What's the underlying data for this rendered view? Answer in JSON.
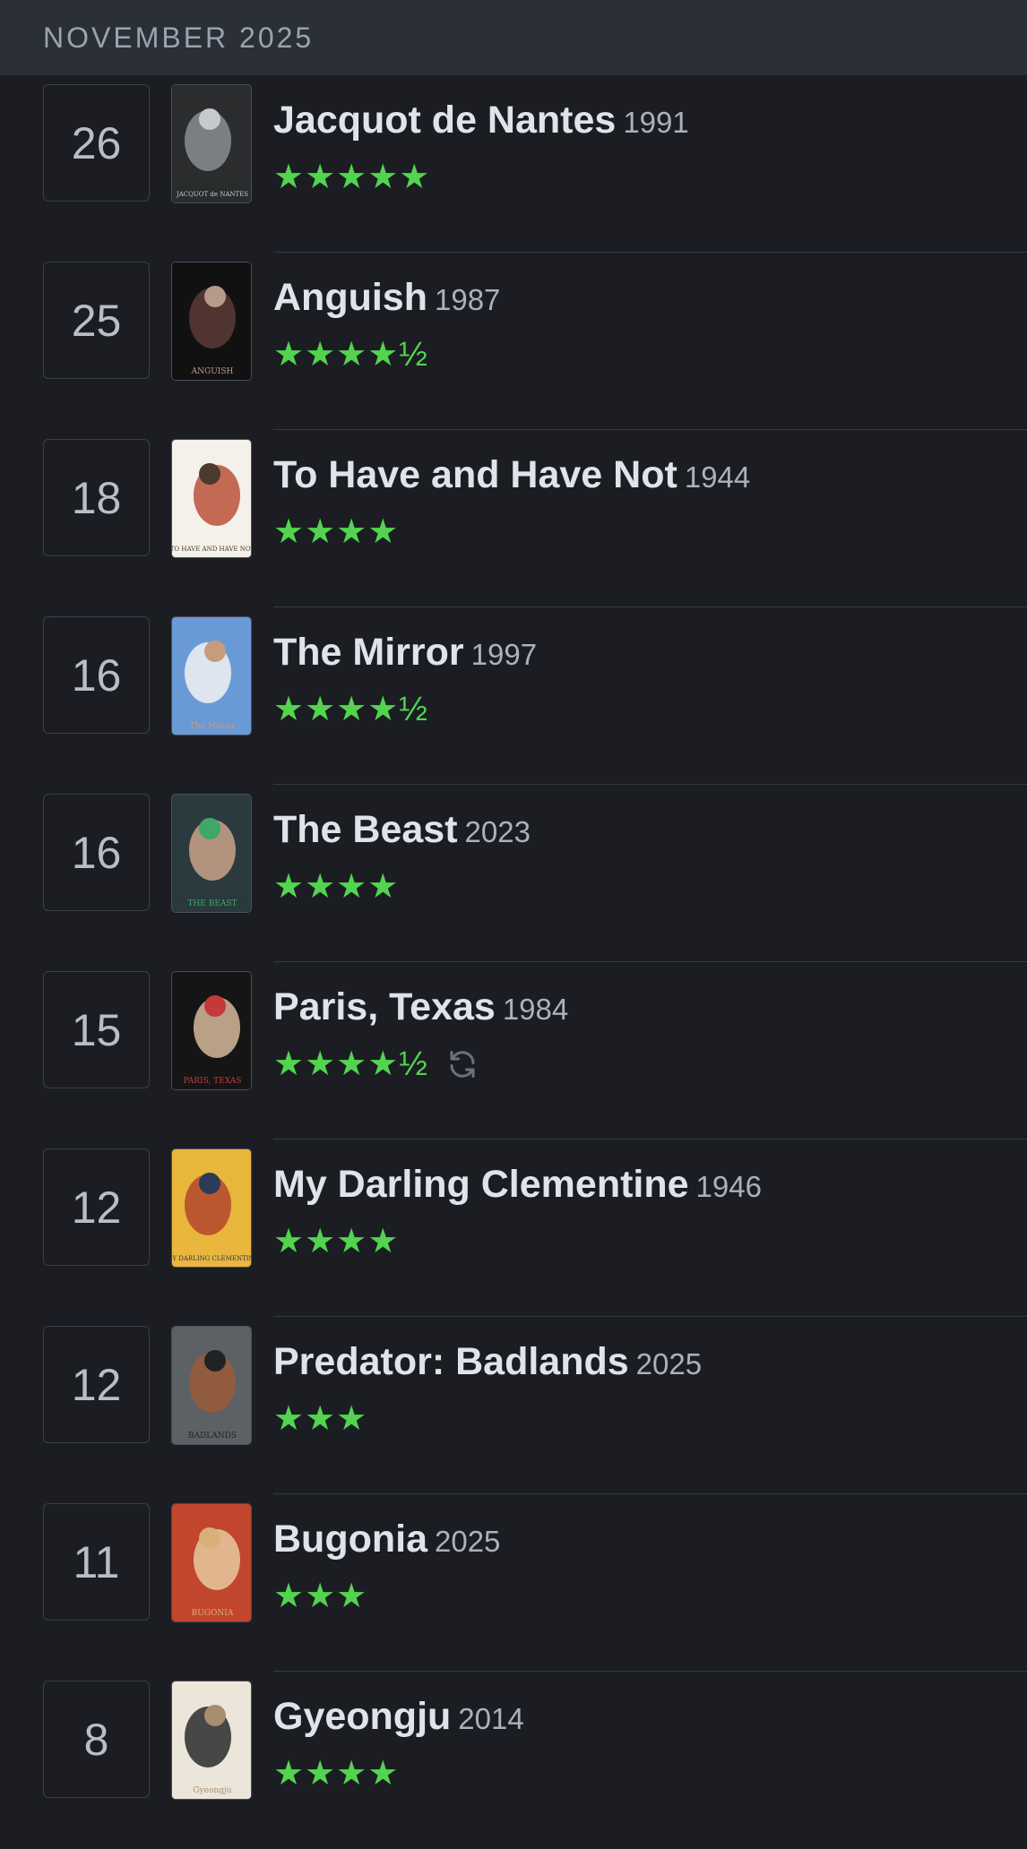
{
  "header": {
    "title": "NOVEMBER 2025"
  },
  "diary": [
    {
      "day": "26",
      "title": "Jacquot de Nantes",
      "year": "1991",
      "stars": "★★★★★",
      "rating": 5,
      "rewatch": false,
      "poster_colors": [
        "#2a2c2e",
        "#8a8e92",
        "#c7c9cc"
      ],
      "poster_text": "JACQUOT de NANTES"
    },
    {
      "day": "25",
      "title": "Anguish",
      "year": "1987",
      "stars": "★★★★½",
      "rating": 4.5,
      "rewatch": false,
      "poster_colors": [
        "#111111",
        "#5a3b35",
        "#b89a8a"
      ],
      "poster_text": "ANGUISH"
    },
    {
      "day": "18",
      "title": "To Have and Have Not",
      "year": "1944",
      "stars": "★★★★",
      "rating": 4,
      "rewatch": false,
      "poster_colors": [
        "#f4f0ea",
        "#b8523a",
        "#4a3a2f"
      ],
      "poster_text": "TO HAVE AND HAVE NOT"
    },
    {
      "day": "16",
      "title": "The Mirror",
      "year": "1997",
      "stars": "★★★★½",
      "rating": 4.5,
      "rewatch": false,
      "poster_colors": [
        "#6a9ad6",
        "#f2f2f2",
        "#c79b7e"
      ],
      "poster_text": "The Mirror"
    },
    {
      "day": "16",
      "title": "The Beast",
      "year": "2023",
      "stars": "★★★★",
      "rating": 4,
      "rewatch": false,
      "poster_colors": [
        "#2b3a3f",
        "#c9a38a",
        "#3fa768"
      ],
      "poster_text": "THE BEAST"
    },
    {
      "day": "15",
      "title": "Paris, Texas",
      "year": "1984",
      "stars": "★★★★½",
      "rating": 4.5,
      "rewatch": true,
      "poster_colors": [
        "#151515",
        "#d6b89a",
        "#c43a3a"
      ],
      "poster_text": "PARIS, TEXAS"
    },
    {
      "day": "12",
      "title": "My Darling Clementine",
      "year": "1946",
      "stars": "★★★★",
      "rating": 4,
      "rewatch": false,
      "poster_colors": [
        "#e9b63c",
        "#b2472d",
        "#2b3b5a"
      ],
      "poster_text": "MY DARLING CLEMENTINE"
    },
    {
      "day": "12",
      "title": "Predator: Badlands",
      "year": "2025",
      "stars": "★★★",
      "rating": 3,
      "rewatch": false,
      "poster_colors": [
        "#5c6166",
        "#9a5a3a",
        "#1f2326"
      ],
      "poster_text": "BADLANDS"
    },
    {
      "day": "11",
      "title": "Bugonia",
      "year": "2025",
      "stars": "★★★",
      "rating": 3,
      "rewatch": false,
      "poster_colors": [
        "#c2452d",
        "#e6c9a0",
        "#d8b07a"
      ],
      "poster_text": "BUGONIA"
    },
    {
      "day": "8",
      "title": "Gyeongju",
      "year": "2014",
      "stars": "★★★★",
      "rating": 4,
      "rewatch": false,
      "poster_colors": [
        "#ece6da",
        "#2a2a2a",
        "#a88d70"
      ],
      "poster_text": "Gyeongju"
    }
  ],
  "colors": {
    "background": "#1b1d22",
    "header_bg": "#2b2f36",
    "star_green": "#52d44f",
    "title_text": "#dfe3ea",
    "year_text": "#a9b2bd"
  },
  "icons": {
    "rewatch": "rewatch-icon"
  }
}
